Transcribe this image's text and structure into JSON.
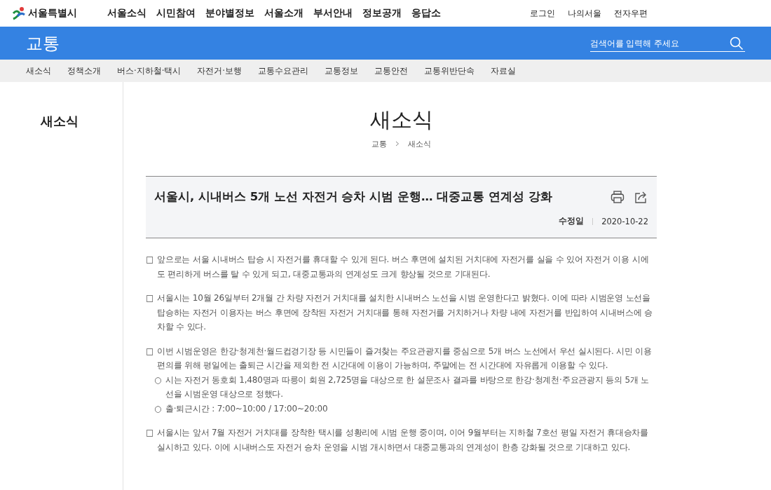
{
  "header": {
    "logo": "서울특별시",
    "menu": [
      "서울소식",
      "시민참여",
      "분야별정보",
      "서울소개",
      "부서안내",
      "정보공개",
      "응답소"
    ],
    "utility": [
      "로그인",
      "나의서울",
      "전자우편"
    ]
  },
  "section": {
    "title": "교통",
    "search": {
      "placeholder": "검색어를 입력해 주세요"
    }
  },
  "subnav": [
    "새소식",
    "정책소개",
    "버스·지하철·택시",
    "자전거·보행",
    "교통수요관리",
    "교통정보",
    "교통안전",
    "교통위반단속",
    "자료실"
  ],
  "sidebar": {
    "title": "새소식"
  },
  "page": {
    "title": "새소식",
    "breadcrumb": [
      "교통",
      "새소식"
    ]
  },
  "article": {
    "title": "서울시, 시내버스 5개 노선 자전거 승차 시범 운행… 대중교통 연계성 강화",
    "date_label": "수정일",
    "date": "2020-10-22",
    "paragraphs": [
      {
        "marker": "□",
        "text": "앞으로는 서울 시내버스 탑승 시 자전거를 휴대할 수 있게 된다. 버스 후면에 설치된 거치대에 자전거를 실을 수 있어 자전거 이용 시에도 편리하게 버스를 탈 수 있게 되고, 대중교통과의 연계성도 크게 향상될 것으로 기대된다."
      },
      {
        "marker": "□",
        "text": "서울시는 10월 26일부터 2개월 간 차량 자전거 거치대를 설치한 시내버스 노선을 시범 운영한다고 밝혔다. 이에 따라 시범운영 노선을 탑승하는 자전거 이용자는 버스 후면에 장착된 자전거 거치대를 통해 자전거를 거치하거나 차량 내에 자전거를 반입하여 시내버스에 승차할 수 있다."
      },
      {
        "marker": "□",
        "text": "이번 시범운영은 한강·청계천·월드컵경기장 등 시민들이 즐겨찾는 주요관광지를 중심으로 5개 버스 노선에서 우선 실시된다. 시민 이용 편의를 위해 평일에는 출퇴근 시간을 제외한 전 시간대에 이용이 가능하며, 주말에는 전 시간대에 자유롭게 이용할 수 있다.",
        "sub": [
          {
            "marker": "○",
            "text": "시는 자전거 동호회 1,480명과 따릉이 회원 2,725명을 대상으로 한 설문조사 결과를 바탕으로 한강·청계천·주요관광지 등의 5개 노선을 시범운영 대상으로 정했다."
          },
          {
            "marker": "○",
            "text": "출·퇴근시간 : 7:00~10:00 / 17:00~20:00"
          }
        ]
      },
      {
        "marker": "□",
        "text": "서울시는 앞서 7월 자전거 거치대를 장착한 택시를 성황리에 시범 운행 중이며, 이어 9월부터는 지하철 7호선 평일 자전거 휴대승차를 실시하고 있다. 이에 시내버스도 자전거 승차 운영을 시범 개시하면서 대중교통과의 연계성이 한층 강화될 것으로 기대하고 있다."
      }
    ]
  }
}
